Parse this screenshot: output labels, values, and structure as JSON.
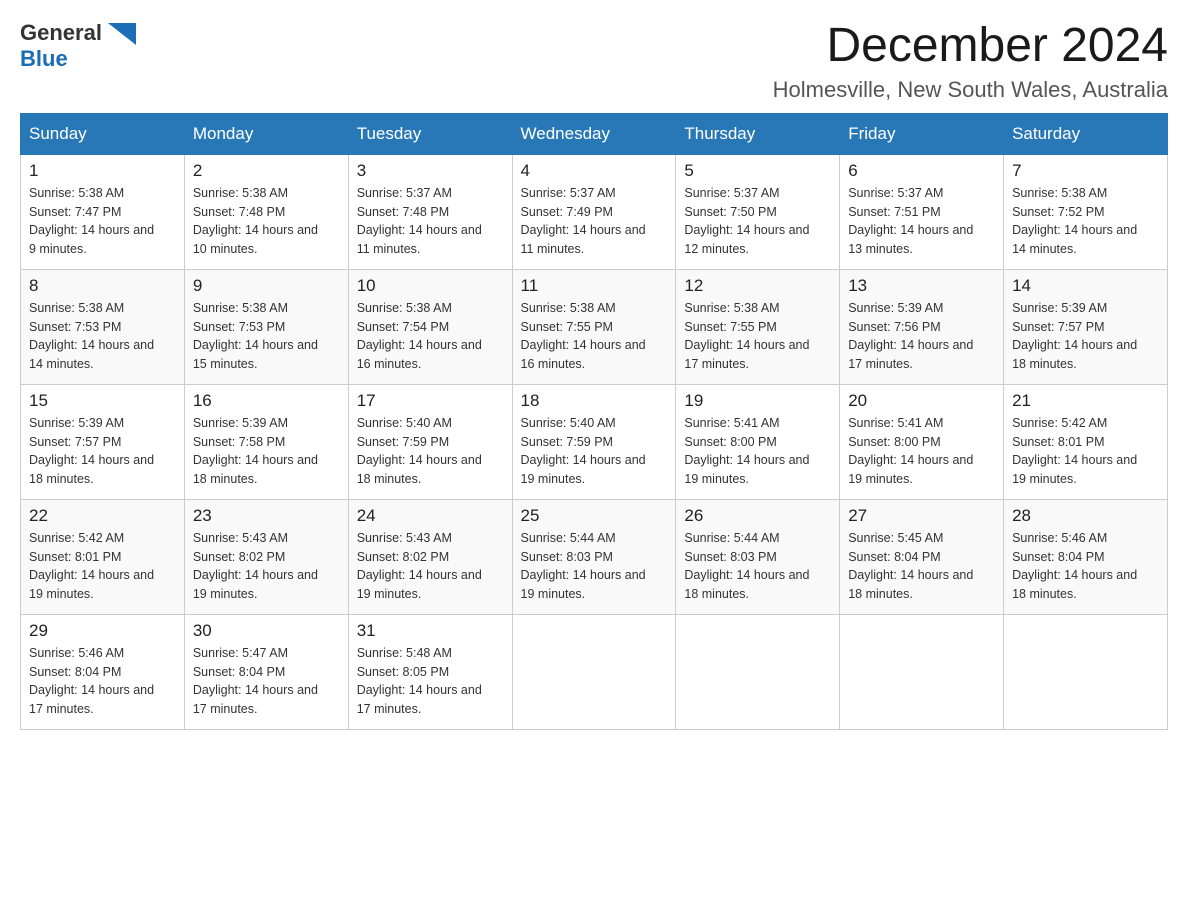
{
  "logo": {
    "text_general": "General",
    "text_blue": "Blue",
    "arrow_color": "#1a6eb5"
  },
  "title": "December 2024",
  "location": "Holmesville, New South Wales, Australia",
  "days_of_week": [
    "Sunday",
    "Monday",
    "Tuesday",
    "Wednesday",
    "Thursday",
    "Friday",
    "Saturday"
  ],
  "weeks": [
    [
      {
        "day": "1",
        "sunrise": "5:38 AM",
        "sunset": "7:47 PM",
        "daylight": "14 hours and 9 minutes."
      },
      {
        "day": "2",
        "sunrise": "5:38 AM",
        "sunset": "7:48 PM",
        "daylight": "14 hours and 10 minutes."
      },
      {
        "day": "3",
        "sunrise": "5:37 AM",
        "sunset": "7:48 PM",
        "daylight": "14 hours and 11 minutes."
      },
      {
        "day": "4",
        "sunrise": "5:37 AM",
        "sunset": "7:49 PM",
        "daylight": "14 hours and 11 minutes."
      },
      {
        "day": "5",
        "sunrise": "5:37 AM",
        "sunset": "7:50 PM",
        "daylight": "14 hours and 12 minutes."
      },
      {
        "day": "6",
        "sunrise": "5:37 AM",
        "sunset": "7:51 PM",
        "daylight": "14 hours and 13 minutes."
      },
      {
        "day": "7",
        "sunrise": "5:38 AM",
        "sunset": "7:52 PM",
        "daylight": "14 hours and 14 minutes."
      }
    ],
    [
      {
        "day": "8",
        "sunrise": "5:38 AM",
        "sunset": "7:53 PM",
        "daylight": "14 hours and 14 minutes."
      },
      {
        "day": "9",
        "sunrise": "5:38 AM",
        "sunset": "7:53 PM",
        "daylight": "14 hours and 15 minutes."
      },
      {
        "day": "10",
        "sunrise": "5:38 AM",
        "sunset": "7:54 PM",
        "daylight": "14 hours and 16 minutes."
      },
      {
        "day": "11",
        "sunrise": "5:38 AM",
        "sunset": "7:55 PM",
        "daylight": "14 hours and 16 minutes."
      },
      {
        "day": "12",
        "sunrise": "5:38 AM",
        "sunset": "7:55 PM",
        "daylight": "14 hours and 17 minutes."
      },
      {
        "day": "13",
        "sunrise": "5:39 AM",
        "sunset": "7:56 PM",
        "daylight": "14 hours and 17 minutes."
      },
      {
        "day": "14",
        "sunrise": "5:39 AM",
        "sunset": "7:57 PM",
        "daylight": "14 hours and 18 minutes."
      }
    ],
    [
      {
        "day": "15",
        "sunrise": "5:39 AM",
        "sunset": "7:57 PM",
        "daylight": "14 hours and 18 minutes."
      },
      {
        "day": "16",
        "sunrise": "5:39 AM",
        "sunset": "7:58 PM",
        "daylight": "14 hours and 18 minutes."
      },
      {
        "day": "17",
        "sunrise": "5:40 AM",
        "sunset": "7:59 PM",
        "daylight": "14 hours and 18 minutes."
      },
      {
        "day": "18",
        "sunrise": "5:40 AM",
        "sunset": "7:59 PM",
        "daylight": "14 hours and 19 minutes."
      },
      {
        "day": "19",
        "sunrise": "5:41 AM",
        "sunset": "8:00 PM",
        "daylight": "14 hours and 19 minutes."
      },
      {
        "day": "20",
        "sunrise": "5:41 AM",
        "sunset": "8:00 PM",
        "daylight": "14 hours and 19 minutes."
      },
      {
        "day": "21",
        "sunrise": "5:42 AM",
        "sunset": "8:01 PM",
        "daylight": "14 hours and 19 minutes."
      }
    ],
    [
      {
        "day": "22",
        "sunrise": "5:42 AM",
        "sunset": "8:01 PM",
        "daylight": "14 hours and 19 minutes."
      },
      {
        "day": "23",
        "sunrise": "5:43 AM",
        "sunset": "8:02 PM",
        "daylight": "14 hours and 19 minutes."
      },
      {
        "day": "24",
        "sunrise": "5:43 AM",
        "sunset": "8:02 PM",
        "daylight": "14 hours and 19 minutes."
      },
      {
        "day": "25",
        "sunrise": "5:44 AM",
        "sunset": "8:03 PM",
        "daylight": "14 hours and 19 minutes."
      },
      {
        "day": "26",
        "sunrise": "5:44 AM",
        "sunset": "8:03 PM",
        "daylight": "14 hours and 18 minutes."
      },
      {
        "day": "27",
        "sunrise": "5:45 AM",
        "sunset": "8:04 PM",
        "daylight": "14 hours and 18 minutes."
      },
      {
        "day": "28",
        "sunrise": "5:46 AM",
        "sunset": "8:04 PM",
        "daylight": "14 hours and 18 minutes."
      }
    ],
    [
      {
        "day": "29",
        "sunrise": "5:46 AM",
        "sunset": "8:04 PM",
        "daylight": "14 hours and 17 minutes."
      },
      {
        "day": "30",
        "sunrise": "5:47 AM",
        "sunset": "8:04 PM",
        "daylight": "14 hours and 17 minutes."
      },
      {
        "day": "31",
        "sunrise": "5:48 AM",
        "sunset": "8:05 PM",
        "daylight": "14 hours and 17 minutes."
      },
      null,
      null,
      null,
      null
    ]
  ],
  "labels": {
    "sunrise": "Sunrise:",
    "sunset": "Sunset:",
    "daylight": "Daylight:"
  }
}
